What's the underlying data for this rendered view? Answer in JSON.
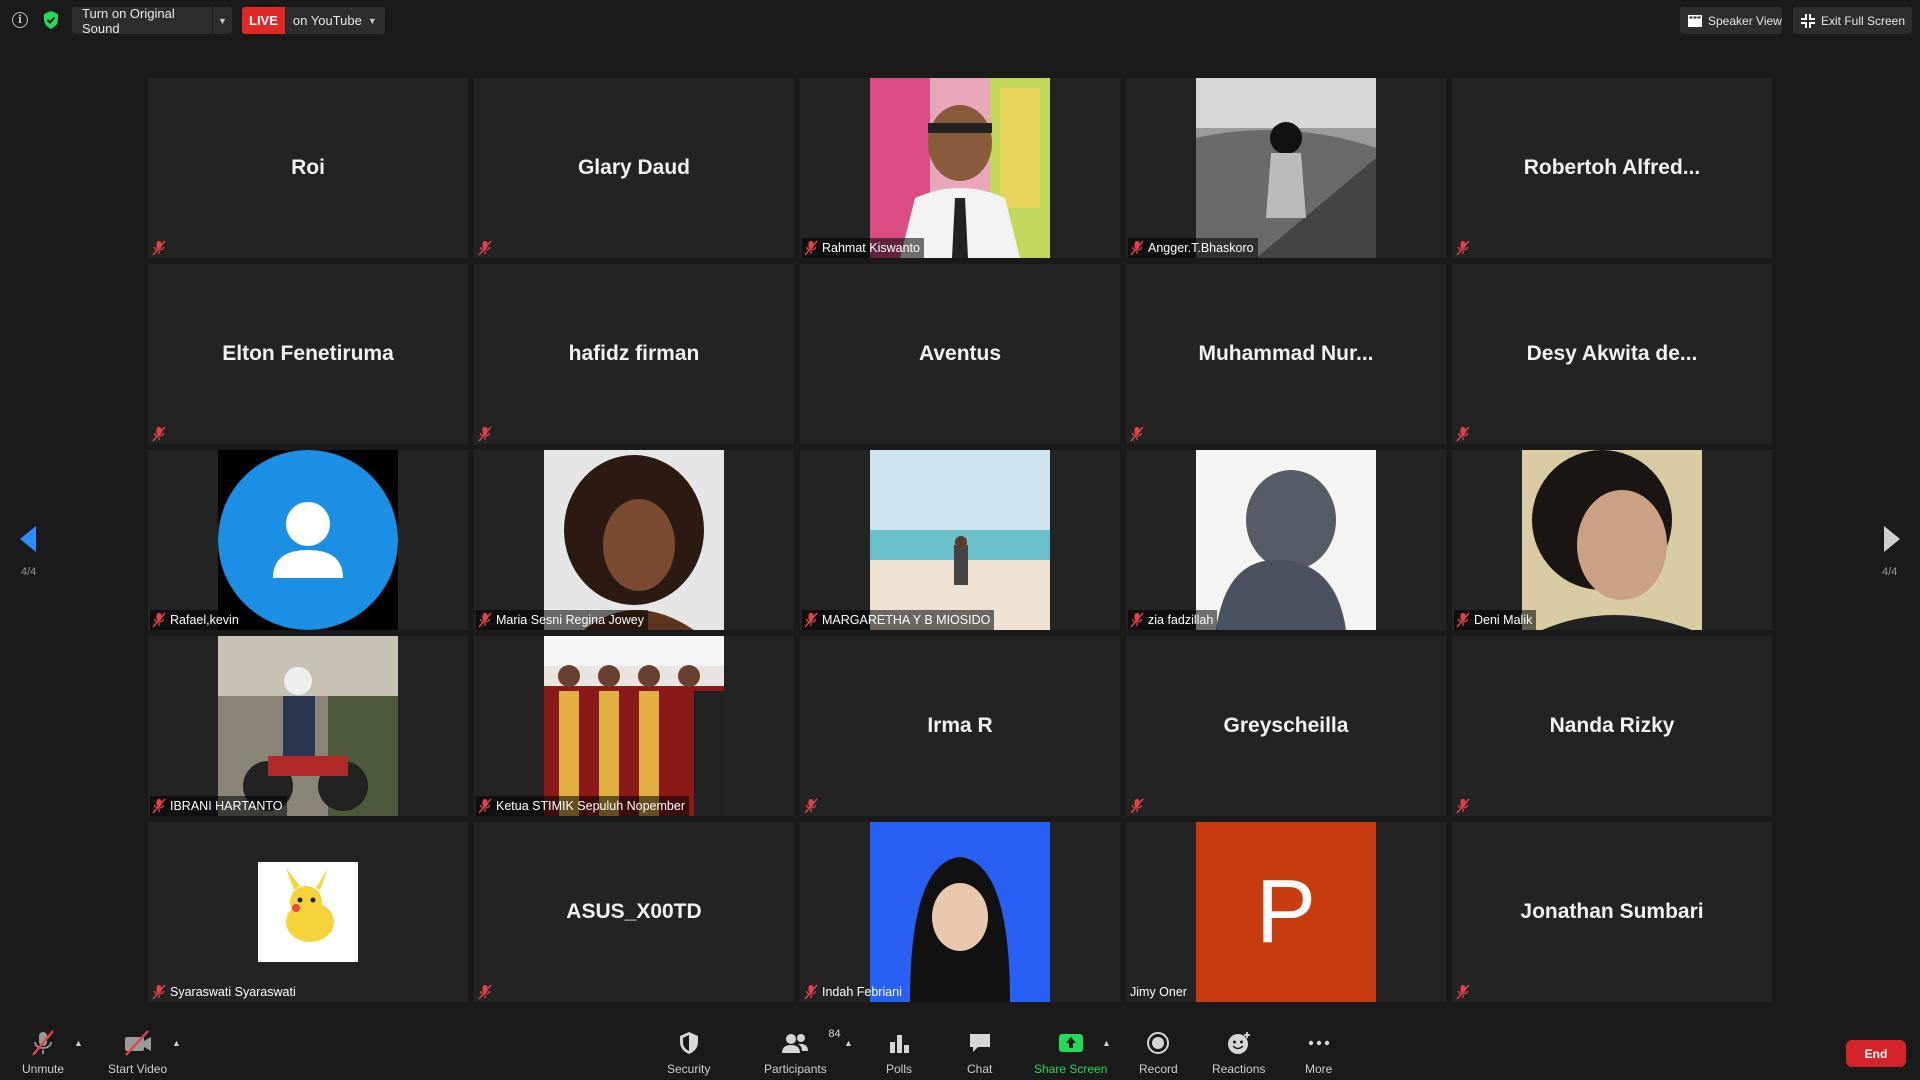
{
  "topbar": {
    "original_sound_label": "Turn on Original Sound",
    "live_badge": "LIVE",
    "live_platform": "on YouTube",
    "speaker_view_label": "Speaker View",
    "exit_fullscreen_label": "Exit Full Screen"
  },
  "pagination": {
    "left": "4/4",
    "right": "4/4"
  },
  "participants": [
    {
      "name": "Roi",
      "video": false
    },
    {
      "name": "Glary Daud",
      "video": false
    },
    {
      "name": "Rahmat Kiswanto",
      "video": true
    },
    {
      "name": "Angger.T.Bhaskoro",
      "video": true
    },
    {
      "name": "Robertoh  Alfred...",
      "video": false
    },
    {
      "name": "Elton Fenetiruma",
      "video": false
    },
    {
      "name": "hafidz firman",
      "video": false
    },
    {
      "name": "Aventus",
      "video": false
    },
    {
      "name": "Muhammad  Nur...",
      "video": false
    },
    {
      "name": "Desy  Akwita  de...",
      "video": false
    },
    {
      "name": "Rafael,kevin",
      "video": true
    },
    {
      "name": "Maria Sesni Regina Jowey",
      "video": true
    },
    {
      "name": "MARGARETHA Y B MIOSIDO",
      "video": true
    },
    {
      "name": "zia fadzillah",
      "video": true
    },
    {
      "name": "Deni Malik",
      "video": true
    },
    {
      "name": "IBRANI HARTANTO",
      "video": true
    },
    {
      "name": "Ketua STIMIK Sepuluh Nopember",
      "video": true
    },
    {
      "name": "Irma R",
      "video": false
    },
    {
      "name": "Greyscheilla",
      "video": false
    },
    {
      "name": "Nanda Rizky",
      "video": false
    },
    {
      "name": "Syaraswati Syaraswati",
      "video": true
    },
    {
      "name": "ASUS_X00TD",
      "video": false
    },
    {
      "name": "Indah Febriani",
      "video": true
    },
    {
      "name": "Jimy Oner",
      "video": true,
      "avatar_letter": "P"
    },
    {
      "name": "Jonathan Sumbari",
      "video": false
    }
  ],
  "toolbar": {
    "unmute": "Unmute",
    "start_video": "Start Video",
    "security": "Security",
    "participants": "Participants",
    "participants_count": "84",
    "polls": "Polls",
    "chat": "Chat",
    "share_screen": "Share Screen",
    "record": "Record",
    "reactions": "Reactions",
    "more": "More",
    "end": "End"
  },
  "colors": {
    "accent_green": "#23d959",
    "live_red": "#e02828",
    "end_red": "#d4242a",
    "mic_off_red": "#e0434a",
    "nav_blue": "#2d8cff",
    "avatar_blue": "#1a8fe3",
    "avatar_orange": "#c93c10"
  },
  "icons": [
    "info-icon",
    "shield-icon",
    "layout-icon",
    "fullscreen-exit-icon",
    "mic-off-icon",
    "video-off-icon",
    "security-icon",
    "participants-icon",
    "polls-icon",
    "chat-icon",
    "share-screen-icon",
    "record-icon",
    "reactions-icon",
    "more-icon",
    "chevron-left-icon",
    "chevron-right-icon",
    "user-silhouette-icon"
  ]
}
